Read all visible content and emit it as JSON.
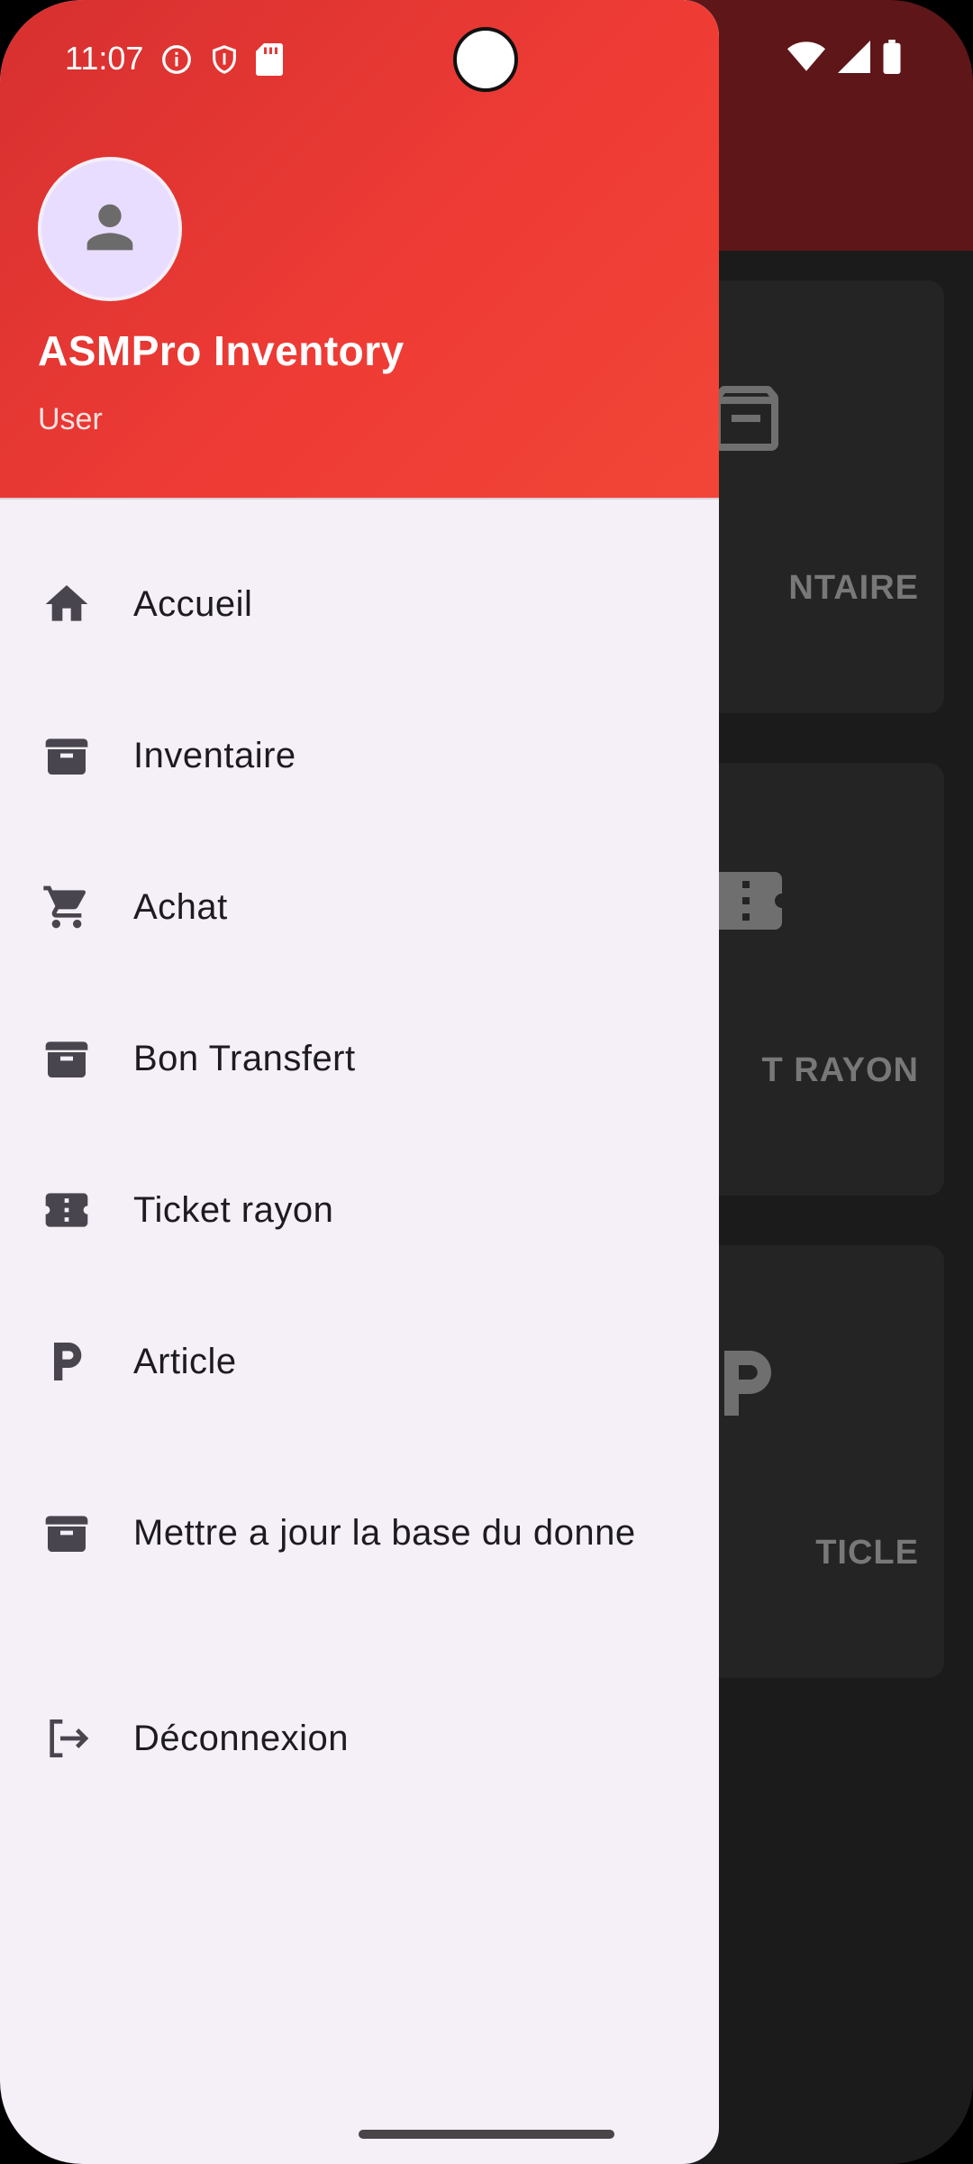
{
  "status_bar": {
    "time": "11:07",
    "left_icons": [
      "info-icon",
      "shield-icon",
      "sd-card-icon"
    ],
    "right_icons": [
      "wifi-icon",
      "signal-icon",
      "battery-icon"
    ]
  },
  "drawer": {
    "header": {
      "title": "ASMPro Inventory",
      "subtitle": "User",
      "gradient_colors": [
        "#d63030",
        "#f24537"
      ]
    },
    "items": [
      {
        "label": "Accueil",
        "icon": "home-icon"
      },
      {
        "label": "Inventaire",
        "icon": "archive-icon"
      },
      {
        "label": "Achat",
        "icon": "cart-icon"
      },
      {
        "label": "Bon Transfert",
        "icon": "archive-icon"
      },
      {
        "label": "Ticket rayon",
        "icon": "ticket-icon"
      },
      {
        "label": "Article",
        "icon": "parking-icon"
      },
      {
        "label": "Mettre a jour la base du donne",
        "icon": "archive-icon"
      },
      {
        "label": "Déconnexion",
        "icon": "logout-icon"
      }
    ]
  },
  "background": {
    "cards": [
      {
        "label": "NTAIRE",
        "icon": "archive-icon"
      },
      {
        "label": "T RAYON",
        "icon": "ticket-icon"
      },
      {
        "label": "TICLE",
        "icon": "parking-icon"
      }
    ]
  },
  "colors": {
    "accent": "#e53935",
    "drawer_bg": "#f5eff7",
    "icon": "#49454f"
  }
}
